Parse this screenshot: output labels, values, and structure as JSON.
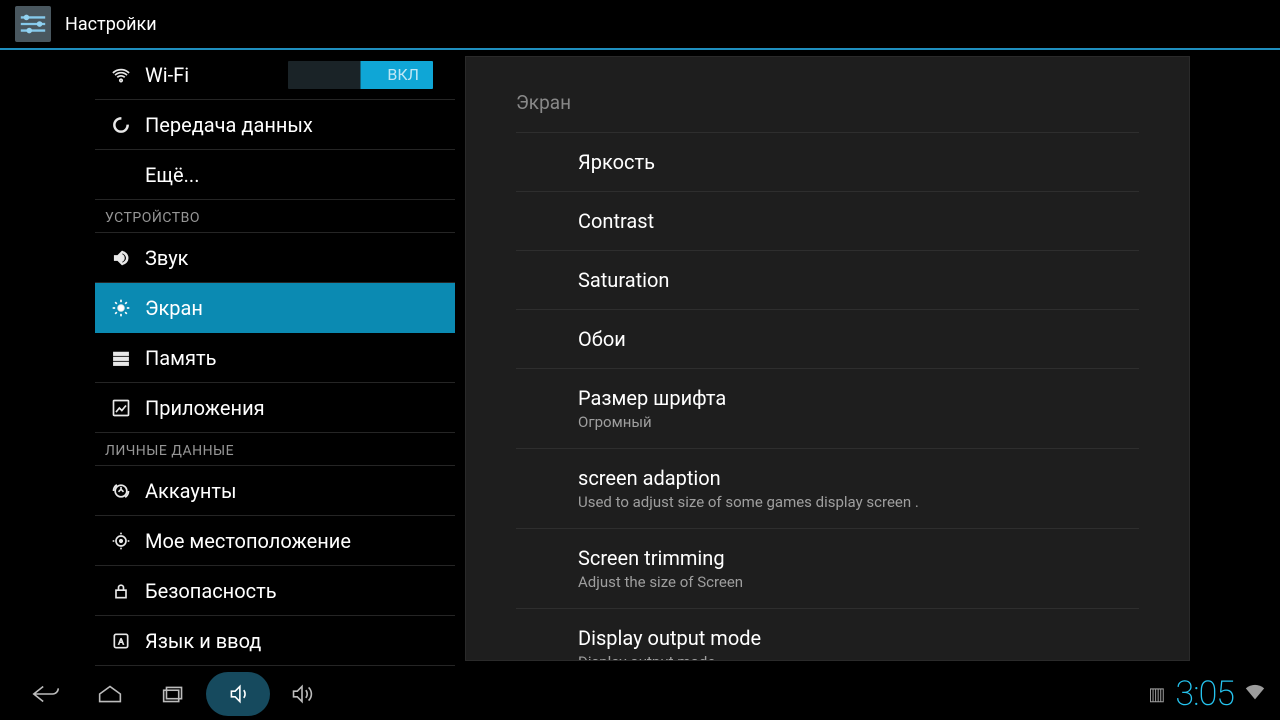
{
  "titlebar": {
    "title": "Настройки"
  },
  "sidebar": {
    "items": [
      {
        "label": "Wi-Fi",
        "toggle": "ВКЛ"
      },
      {
        "label": "Передача данных"
      },
      {
        "label": "Ещё..."
      }
    ],
    "section_device": "УСТРОЙСТВО",
    "device_items": [
      {
        "label": "Звук"
      },
      {
        "label": "Экран"
      },
      {
        "label": "Память"
      },
      {
        "label": "Приложения"
      }
    ],
    "section_personal": "ЛИЧНЫЕ ДАННЫЕ",
    "personal_items": [
      {
        "label": "Аккаунты"
      },
      {
        "label": "Мое местоположение"
      },
      {
        "label": "Безопасность"
      },
      {
        "label": "Язык и ввод"
      }
    ]
  },
  "panel": {
    "header": "Экран",
    "items": [
      {
        "title": "Яркость"
      },
      {
        "title": "Contrast"
      },
      {
        "title": "Saturation"
      },
      {
        "title": "Обои"
      },
      {
        "title": "Размер шрифта",
        "sub": "Огромный"
      },
      {
        "title": "screen adaption",
        "sub": "Used to adjust size of some games display screen ."
      },
      {
        "title": "Screen trimming",
        "sub": "Adjust the size of Screen"
      },
      {
        "title": "Display output mode",
        "sub": "Display output mode"
      }
    ]
  },
  "statusbar": {
    "clock": "3:05"
  }
}
